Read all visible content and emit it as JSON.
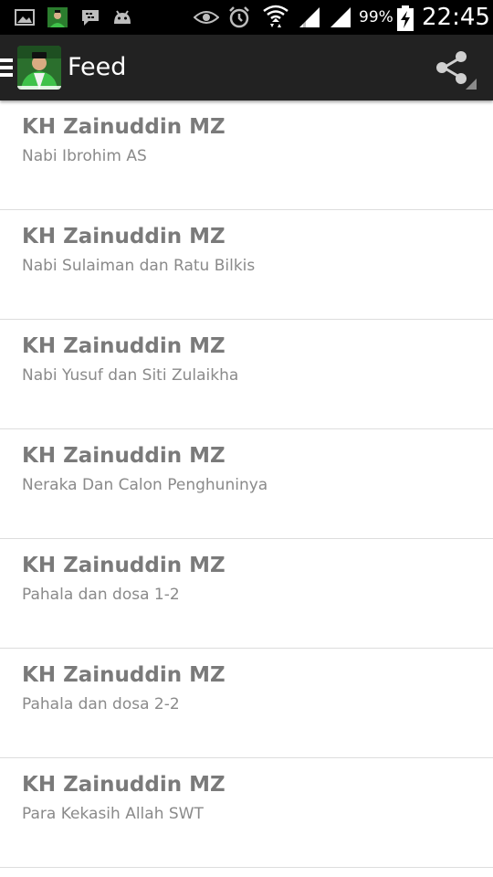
{
  "status_bar": {
    "battery_percent": "99%",
    "time": "22:45",
    "icons": [
      "gallery-icon",
      "app-avatar-icon",
      "bbm-icon",
      "android-icon",
      "eye-icon",
      "alarm-icon",
      "wifi-icon",
      "signal-icon",
      "signal-icon",
      "battery-charging-icon"
    ]
  },
  "action_bar": {
    "title": "Feed",
    "icons": [
      "menu-icon",
      "app-logo",
      "share-icon"
    ]
  },
  "feed": {
    "items": [
      {
        "title": "KH Zainuddin MZ",
        "subtitle": "Nabi Ibrohim AS"
      },
      {
        "title": "KH Zainuddin MZ",
        "subtitle": "Nabi Sulaiman dan Ratu Bilkis"
      },
      {
        "title": "KH Zainuddin MZ",
        "subtitle": "Nabi Yusuf dan Siti Zulaikha"
      },
      {
        "title": "KH Zainuddin MZ",
        "subtitle": "Neraka Dan Calon Penghuninya"
      },
      {
        "title": "KH Zainuddin MZ",
        "subtitle": "Pahala dan dosa 1-2"
      },
      {
        "title": "KH Zainuddin MZ",
        "subtitle": "Pahala dan dosa 2-2"
      },
      {
        "title": "KH Zainuddin MZ",
        "subtitle": "Para Kekasih Allah SWT"
      }
    ]
  },
  "colors": {
    "status_bar_bg": "#000000",
    "action_bar_bg": "#222222",
    "title_text": "#7a7a7a",
    "subtitle_text": "#8a8a8a",
    "divider": "#dddddd",
    "avatar_green": "#2fa83a"
  }
}
